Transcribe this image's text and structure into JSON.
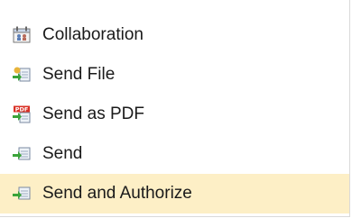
{
  "menu": {
    "items": [
      {
        "label": "Collaboration",
        "icon": "collaboration-icon",
        "highlighted": false
      },
      {
        "label": "Send File",
        "icon": "send-file-icon",
        "highlighted": false
      },
      {
        "label": "Send as PDF",
        "icon": "send-pdf-icon",
        "highlighted": false
      },
      {
        "label": "Send",
        "icon": "send-icon",
        "highlighted": false
      },
      {
        "label": "Send and Authorize",
        "icon": "send-authorize-icon",
        "highlighted": true
      }
    ],
    "colors": {
      "highlight": "#fdefc6",
      "arrow": "#3aa33a",
      "pdf": "#d93025"
    }
  }
}
